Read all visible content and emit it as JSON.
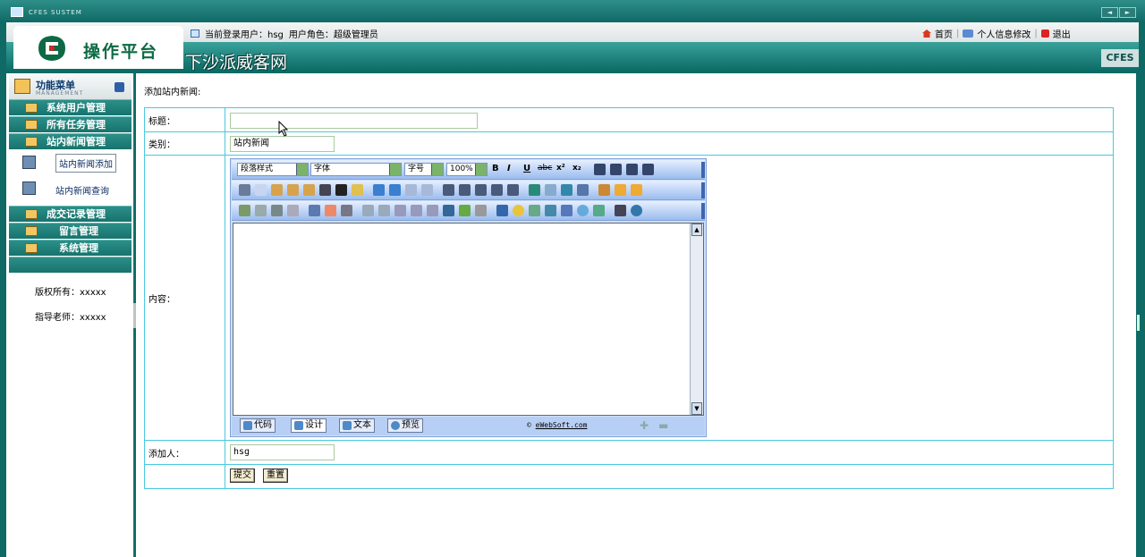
{
  "titlebar": {
    "app_title": "CFES SUSTEM",
    "nav_prev": "◄",
    "nav_next": "►"
  },
  "header": {
    "logo_text": "操作平台",
    "site_name": "下沙派威客网",
    "user_label": "当前登录用户：hsg",
    "role_label": "用户角色：超级管理员",
    "links": {
      "home": "首页",
      "profile": "个人信息修改",
      "logout": "退出"
    },
    "brand": "CFES"
  },
  "sidebar": {
    "title": "功能菜单",
    "subtitle": "MANAGEMENT",
    "menus": [
      "系统用户管理",
      "所有任务管理",
      "站内新闻管理",
      "成交记录管理",
      "留言管理",
      "系统管理"
    ],
    "subitems": [
      "站内新闻添加",
      "站内新闻查询"
    ],
    "copyright": "版权所有：xxxxx",
    "teacher": "指导老师：xxxxx"
  },
  "form": {
    "page_title": "添加站内新闻:",
    "labels": {
      "title": "标题：",
      "category": "类别：",
      "content": "内容：",
      "author": "添加人："
    },
    "values": {
      "title": "",
      "category": "站内新闻",
      "author": "hsg"
    },
    "buttons": {
      "submit": "提交",
      "reset": "重置"
    }
  },
  "editor": {
    "selects": {
      "paragraph": "段落样式",
      "font": "字体",
      "size": "字号",
      "zoom": "100%"
    },
    "format_buttons": [
      "B",
      "I",
      "U",
      "abc",
      "x²",
      "x₂"
    ],
    "tabs": [
      "代码",
      "设计",
      "文本",
      "预览"
    ],
    "active_tab": "设计",
    "credit_prefix": "©",
    "credit_link": "eWebSoft.com"
  }
}
